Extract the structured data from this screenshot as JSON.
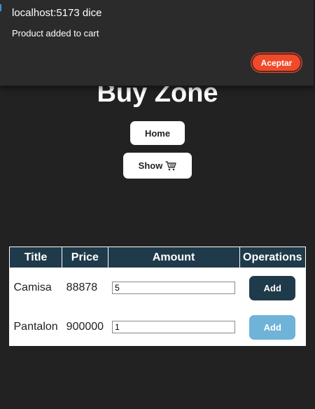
{
  "dialog": {
    "origin": "localhost:5173 dice",
    "message": "Product added to cart",
    "ok_label": "Aceptar",
    "accent": "#f04a2a"
  },
  "page": {
    "title": "Buy Zone",
    "home_label": "Home",
    "show_label": "Show"
  },
  "table": {
    "headers": [
      "Title",
      "Price",
      "Amount",
      "Operations"
    ],
    "rows": [
      {
        "title": "Camisa",
        "price": "88878",
        "amount": "5",
        "action": "Add"
      },
      {
        "title": "Pantalon",
        "price": "900000",
        "amount": "1",
        "action": "Add"
      }
    ]
  },
  "colors": {
    "background": "#222222",
    "header_bg": "#1f3a4a",
    "add_active": "#1f3a4a",
    "add_light": "#6fb3d8"
  }
}
